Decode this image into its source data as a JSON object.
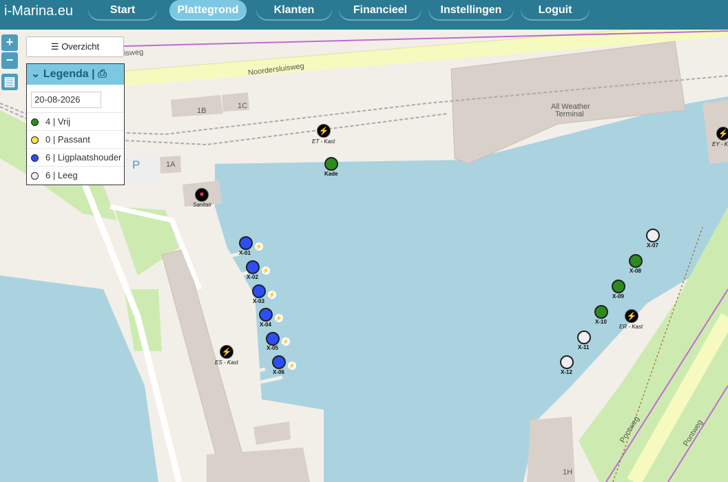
{
  "app": {
    "brand": "i-Marina.eu"
  },
  "nav": [
    {
      "label": "Start",
      "active": false
    },
    {
      "label": "Plattegrond",
      "active": true
    },
    {
      "label": "Klanten",
      "active": false
    },
    {
      "label": "Financieel",
      "active": false
    },
    {
      "label": "Instellingen",
      "active": false
    },
    {
      "label": "Loguit",
      "active": false
    }
  ],
  "controls": {
    "zoom_in": "+",
    "zoom_out": "−",
    "overview": "Overzicht"
  },
  "legend": {
    "title": "Legenda |",
    "date": "20-08-2026",
    "rows": [
      {
        "label": "4 | Vrij",
        "color": "#2f8a1e"
      },
      {
        "label": "0 | Passant",
        "color": "#f3e34a"
      },
      {
        "label": "6 | Ligplaatshouder",
        "color": "#2d4ef5"
      },
      {
        "label": "6 | Leeg",
        "color": "#eeeeee"
      }
    ]
  },
  "map_labels": {
    "road1": "Noordersluisweg",
    "road2": "uisweg",
    "road3": "Pontweg",
    "road4": "Pontweg",
    "terminal1": "All Weather",
    "terminal2": "Terminal",
    "b1": "1B",
    "b2": "1C",
    "b3": "1A",
    "b4": "1H",
    "parking": "P"
  },
  "berths": [
    {
      "id": "X-01",
      "status": "Ligplaatshouder",
      "plug": "black"
    },
    {
      "id": "X-02",
      "status": "Ligplaatshouder",
      "plug": "black"
    },
    {
      "id": "X-03",
      "status": "Ligplaatshouder",
      "plug": "red"
    },
    {
      "id": "X-04",
      "status": "Ligplaatshouder",
      "plug": "red"
    },
    {
      "id": "X-05",
      "status": "Ligplaatshouder",
      "plug": "black"
    },
    {
      "id": "X-06",
      "status": "Ligplaatshouder",
      "plug": "black"
    },
    {
      "id": "X-07",
      "status": "Leeg"
    },
    {
      "id": "X-08",
      "status": "Vrij"
    },
    {
      "id": "X-09",
      "status": "Vrij"
    },
    {
      "id": "X-10",
      "status": "Vrij"
    },
    {
      "id": "X-11",
      "status": "Leeg"
    },
    {
      "id": "X-12",
      "status": "Leeg"
    },
    {
      "id": "Kade",
      "status": "Vrij"
    }
  ],
  "kasten": [
    {
      "label": "ET - Kast",
      "state": "ok"
    },
    {
      "label": "EY - K",
      "state": "ok-white"
    },
    {
      "label": "ES - Kast",
      "state": "ok"
    },
    {
      "label": "ER - Kast",
      "state": "alert"
    },
    {
      "label": "Sanitair",
      "state": "lock"
    }
  ]
}
